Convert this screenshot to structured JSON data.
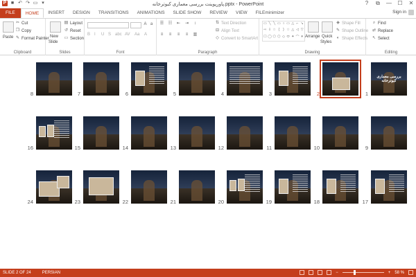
{
  "window": {
    "title": "پاورپوینت بررسی معماری کبوترخانه.pptx - PowerPoint",
    "controls": [
      "?",
      "⧉",
      "—",
      "☐",
      "✕"
    ],
    "signin": "Sign in"
  },
  "tabs": [
    "FILE",
    "HOME",
    "INSERT",
    "DESIGN",
    "TRANSITIONS",
    "ANIMATIONS",
    "SLIDE SHOW",
    "REVIEW",
    "VIEW",
    "FILEminimizer"
  ],
  "ribbon": {
    "clipboard": {
      "paste": "Paste",
      "cut": "Cut",
      "copy": "Copy",
      "format_painter": "Format Painter",
      "label": "Clipboard"
    },
    "slides": {
      "new_slide": "New",
      "new_slide2": "Slide",
      "layout": "Layout",
      "reset": "Reset",
      "section": "Section",
      "label": "Slides"
    },
    "font": {
      "label": "Font",
      "buttons": [
        "B",
        "I",
        "U",
        "S",
        "abc",
        "AV",
        "Aa",
        "A"
      ]
    },
    "paragraph": {
      "text_direction": "Text Direction",
      "align_text": "Align Text",
      "convert": "Convert to SmartArt",
      "label": "Paragraph"
    },
    "drawing": {
      "arrange": "Arrange",
      "quick_styles": "Quick",
      "quick_styles2": "Styles",
      "shape_fill": "Shape Fill",
      "shape_outline": "Shape Outline",
      "shape_effects": "Shape Effects",
      "label": "Drawing"
    },
    "editing": {
      "find": "Find",
      "replace": "Replace",
      "select": "Select",
      "label": "Editing"
    }
  },
  "slides": [
    {
      "num": "1",
      "kind": "title",
      "heading": "بررسی معماری کبوترخانه"
    },
    {
      "num": "2",
      "kind": "photo-title",
      "selected": true
    },
    {
      "num": "3",
      "kind": "text-photo"
    },
    {
      "num": "4",
      "kind": "text"
    },
    {
      "num": "5",
      "kind": "plain-title"
    },
    {
      "num": "6",
      "kind": "text-photo"
    },
    {
      "num": "7",
      "kind": "plain-title"
    },
    {
      "num": "8",
      "kind": "plain-title"
    },
    {
      "num": "9",
      "kind": "plain-title"
    },
    {
      "num": "10",
      "kind": "plain-title"
    },
    {
      "num": "11",
      "kind": "plain-title"
    },
    {
      "num": "12",
      "kind": "plain-title"
    },
    {
      "num": "13",
      "kind": "plain-title"
    },
    {
      "num": "14",
      "kind": "plain-title"
    },
    {
      "num": "15",
      "kind": "plain-title"
    },
    {
      "num": "16",
      "kind": "multi-photo"
    },
    {
      "num": "17",
      "kind": "text-photo"
    },
    {
      "num": "18",
      "kind": "text-photo"
    },
    {
      "num": "19",
      "kind": "text-photo"
    },
    {
      "num": "20",
      "kind": "multi-photo"
    },
    {
      "num": "21",
      "kind": "plain-title"
    },
    {
      "num": "22",
      "kind": "plain-title"
    },
    {
      "num": "23",
      "kind": "dark-photo"
    },
    {
      "num": "24",
      "kind": "laptop"
    }
  ],
  "status": {
    "slide_info": "SLIDE 2 OF 24",
    "language": "PERSIAN",
    "zoom": "58 %",
    "zoom_level": 58
  },
  "colors": {
    "accent": "#c43e1c",
    "slide_bg": "#1f2a3a"
  }
}
